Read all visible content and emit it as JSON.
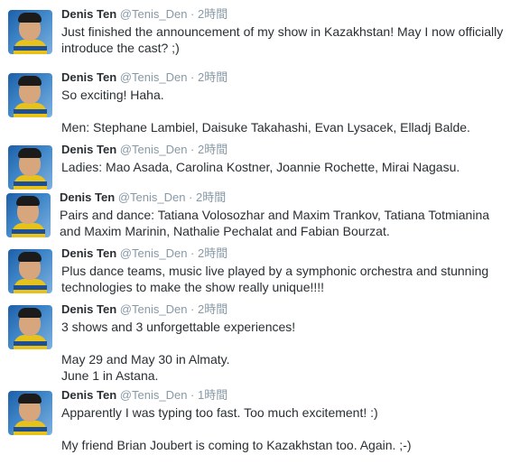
{
  "user": {
    "name": "Denis Ten",
    "handle": "@Tenis_Den"
  },
  "tweets": [
    {
      "time": "2時間",
      "lines": [
        "Just finished the announcement of my show in Kazakhstan! May I now officially introduce the cast? ;)"
      ]
    },
    {
      "time": "2時間",
      "lines": [
        "So exciting! Haha.",
        "Men: Stephane Lambiel, Daisuke Takahashi, Evan Lysacek, Elladj Balde."
      ]
    },
    {
      "time": "2時間",
      "lines": [
        "Ladies: Mao Asada, Carolina Kostner, Joannie Rochette, Mirai Nagasu."
      ]
    },
    {
      "time": "2時間",
      "lines": [
        "Pairs and dance: Tatiana Volosozhar and Maxim Trankov, Tatiana Totmianina and Maxim Marinin, Nathalie Pechalat and Fabian Bourzat."
      ]
    },
    {
      "time": "2時間",
      "lines": [
        "Plus dance teams, music live played by a symphonic orchestra and stunning technologies to make the show really unique!!!!"
      ]
    },
    {
      "time": "2時間",
      "lines": [
        "3 shows and 3 unforgettable experiences!",
        "May 29 and May 30 in Almaty.",
        "June 1 in Astana."
      ]
    },
    {
      "time": "1時間",
      "lines": [
        "Apparently I was typing too fast. Too much excitement! :)",
        "My friend Brian Joubert is coming to Kazakhstan too. Again. ;-)"
      ]
    }
  ]
}
